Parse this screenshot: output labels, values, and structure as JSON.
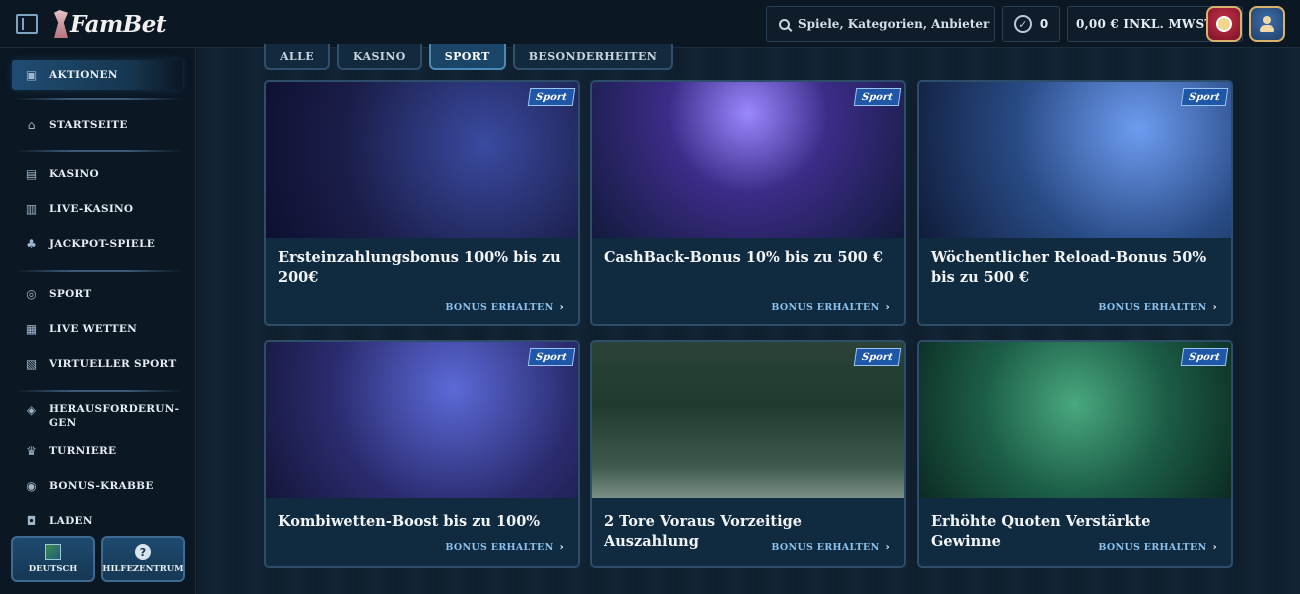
{
  "header": {
    "logo_text": "FamBet",
    "search_placeholder": "Spiele, Kategorien, Anbieter",
    "bet_count": "0",
    "balance": "0,00 € INKL. MWST."
  },
  "sidebar": {
    "items": [
      {
        "label": "AKTIONEN",
        "icon": "gift-icon"
      },
      {
        "label": "STARTSEITE",
        "icon": "home-icon"
      },
      {
        "label": "KASINO",
        "icon": "slot-machine-icon"
      },
      {
        "label": "LIVE-KASINO",
        "icon": "card-icon"
      },
      {
        "label": "JACKPOT-SPIELE",
        "icon": "clover-icon"
      },
      {
        "label": "SPORT",
        "icon": "ball-icon"
      },
      {
        "label": "LIVE WETTEN",
        "icon": "live-icon"
      },
      {
        "label": "VIRTUELLER SPORT",
        "icon": "virtual-icon"
      },
      {
        "label": "HERAUSFORDERUN-GEN",
        "icon": "challenge-icon"
      },
      {
        "label": "TURNIERE",
        "icon": "trophy-icon"
      },
      {
        "label": "BONUS-KRABBE",
        "icon": "crab-icon"
      },
      {
        "label": "LADEN",
        "icon": "shop-icon"
      }
    ],
    "language_label": "DEUTSCH",
    "help_label": "HILFEZENTRUM"
  },
  "tabs": [
    {
      "label": "ALLE"
    },
    {
      "label": "KASINO"
    },
    {
      "label": "SPORT"
    },
    {
      "label": "BESONDERHEITEN"
    }
  ],
  "cards": [
    {
      "title": "Ersteinzahlungsbonus 100% bis zu 200€",
      "badge": "Sport",
      "cta": "BONUS ERHALTEN"
    },
    {
      "title": "CashBack-Bonus 10% bis zu 500 €",
      "badge": "Sport",
      "cta": "BONUS ERHALTEN"
    },
    {
      "title": "Wöchentlicher Reload-Bonus 50% bis zu 500 €",
      "badge": "Sport",
      "cta": "BONUS ERHALTEN"
    },
    {
      "title": "Kombiwetten-Boost bis zu 100%",
      "badge": "Sport",
      "cta": "BONUS ERHALTEN"
    },
    {
      "title": "2 Tore Voraus Vorzeitige Auszahlung",
      "badge": "Sport",
      "cta": "BONUS ERHALTEN"
    },
    {
      "title": "Erhöhte Quoten Verstärkte Gewinne",
      "badge": "Sport",
      "cta": "BONUS ERHALTEN"
    }
  ],
  "colors": {
    "accent": "#4a8ab8",
    "badge": "#1f57a8",
    "cta": "#8cc2ee"
  }
}
